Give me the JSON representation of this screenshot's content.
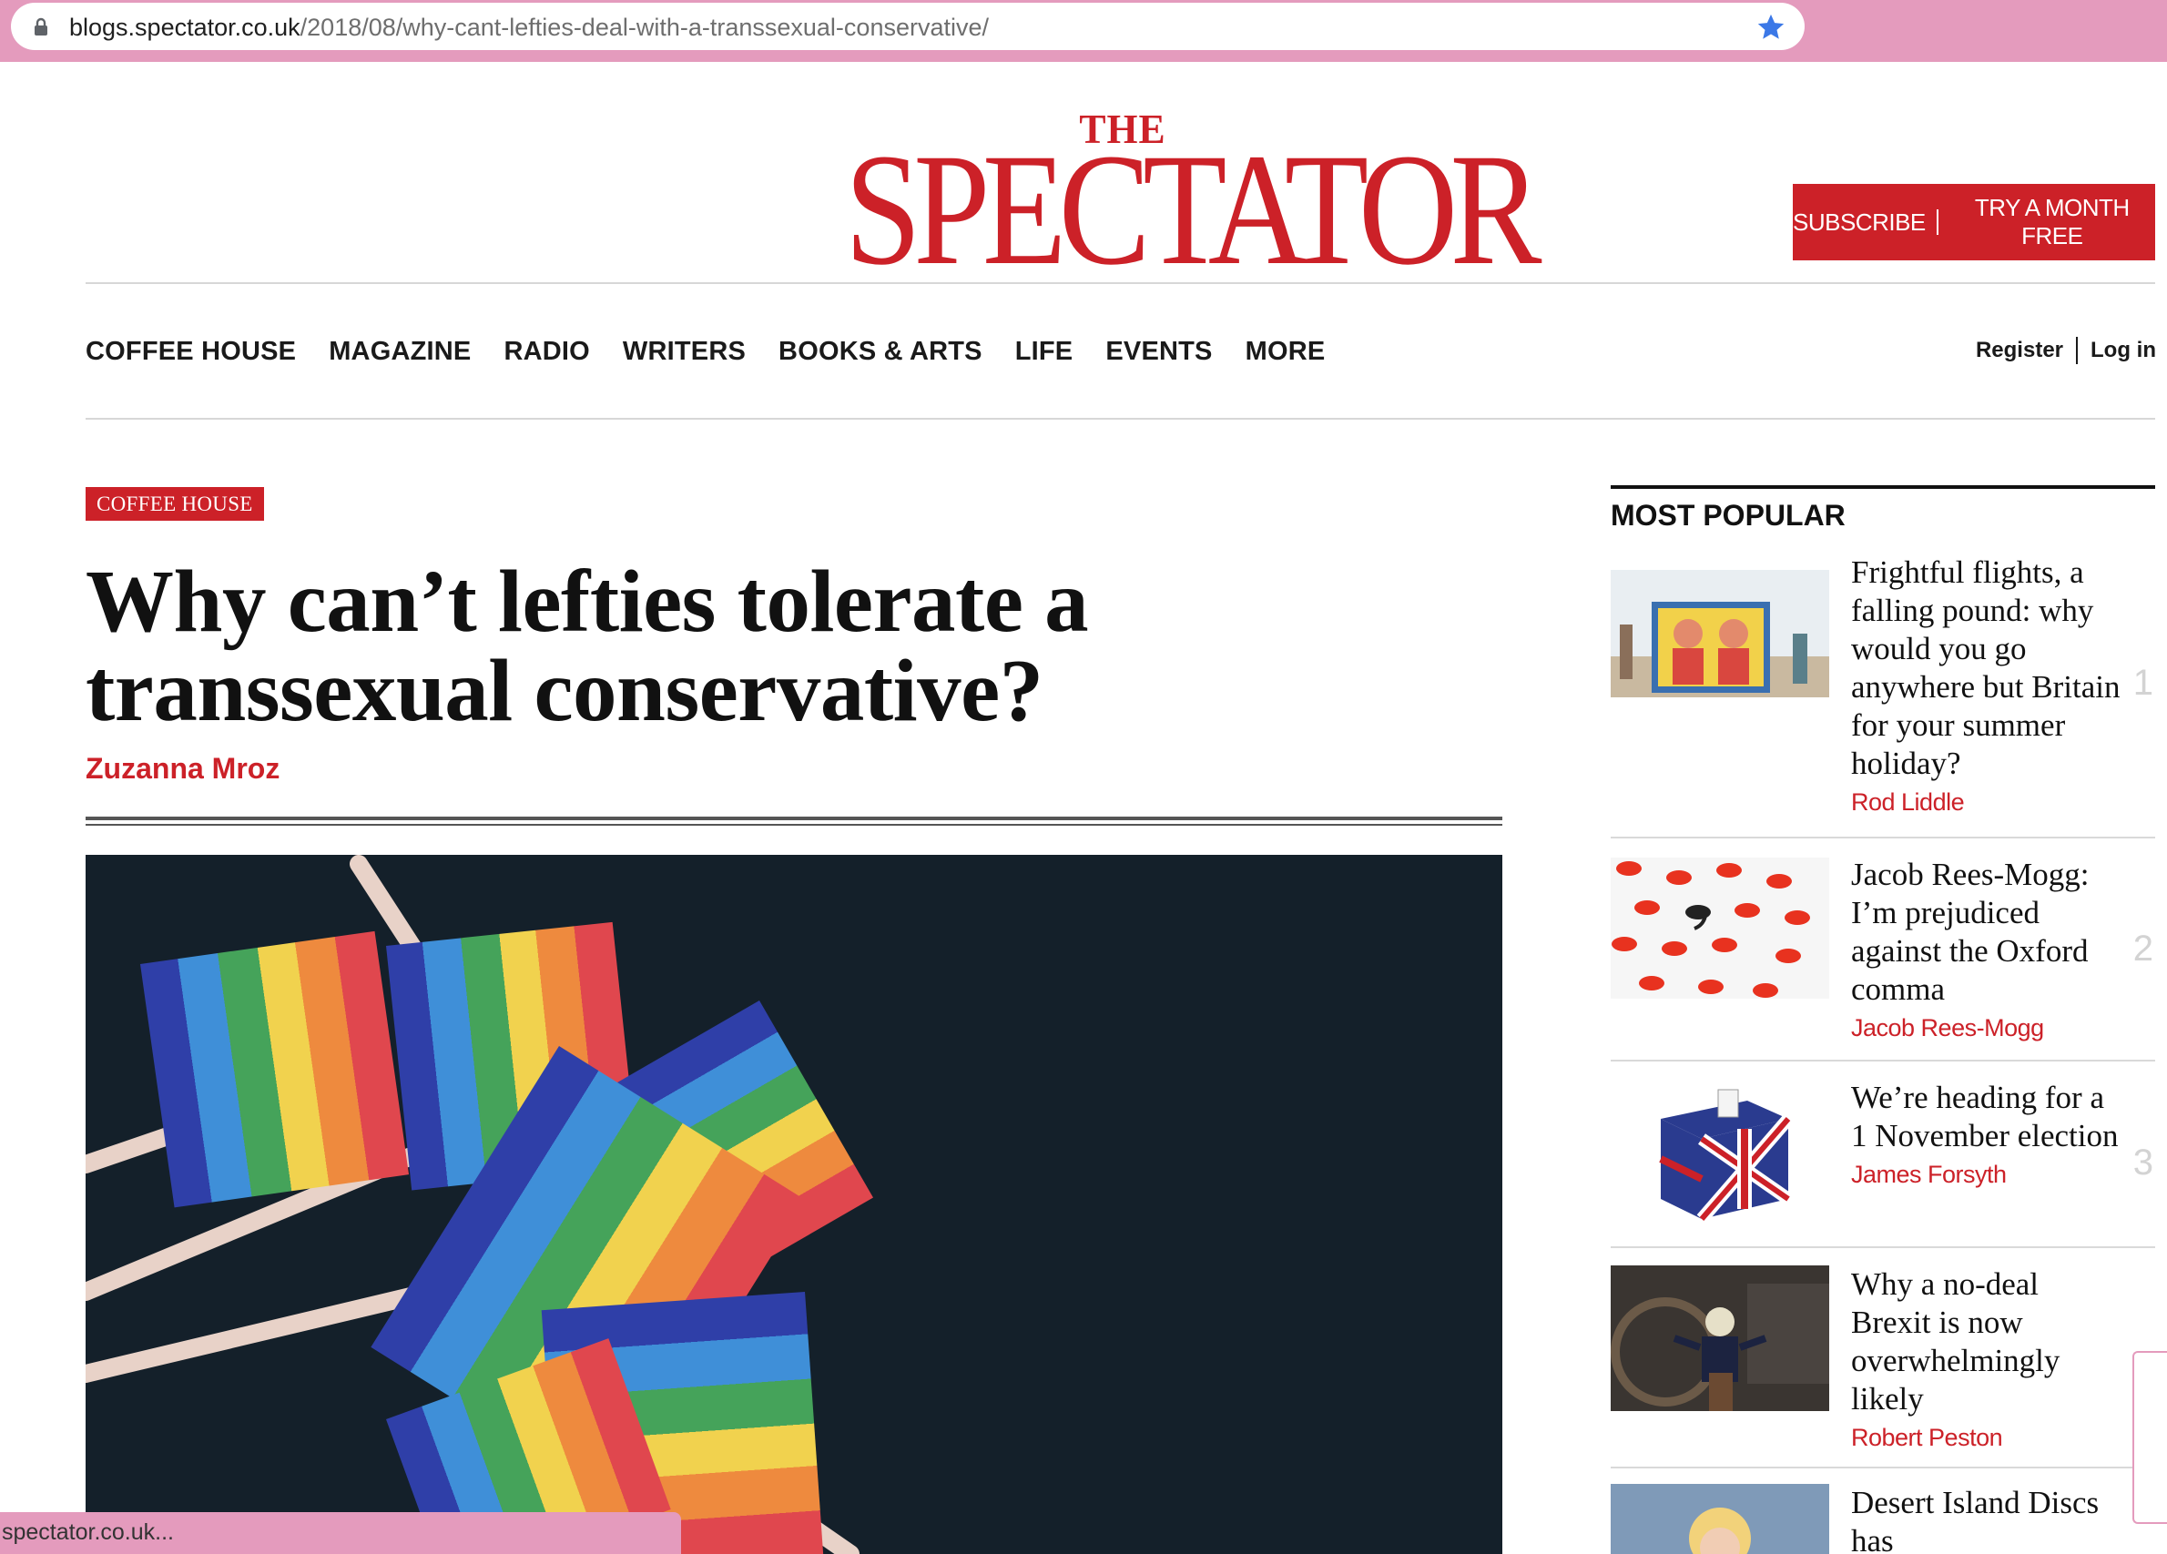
{
  "browser": {
    "url_host": "blogs.spectator.co.uk",
    "url_path": "/2018/08/why-cant-lefties-deal-with-a-transsexual-conservative/",
    "status_text": "spectator.co.uk..."
  },
  "header": {
    "logo_the": "THE",
    "logo_main": "SPECTATOR",
    "subscribe_label": "SUBSCRIBE",
    "subscribe_offer": "TRY A MONTH FREE"
  },
  "nav": {
    "items": [
      "COFFEE HOUSE",
      "MAGAZINE",
      "RADIO",
      "WRITERS",
      "BOOKS & ARTS",
      "LIFE",
      "EVENTS",
      "MORE"
    ],
    "register": "Register",
    "login": "Log in"
  },
  "article": {
    "section": "COFFEE HOUSE",
    "headline": "Why can’t lefties tolerate a transsexual conservative?",
    "author": "Zuzanna Mroz"
  },
  "sidebar": {
    "title": "MOST POPULAR",
    "items": [
      {
        "title": "Frightful flights, a falling pound: why would you go anywhere but Britain for your summer holiday?",
        "author": "Rod Liddle",
        "rank": "1"
      },
      {
        "title": "Jacob Rees-Mogg: I’m prejudiced against the Oxford comma",
        "author": "Jacob Rees-Mogg",
        "rank": "2"
      },
      {
        "title": "We’re heading for a 1 November election",
        "author": "James Forsyth",
        "rank": "3"
      },
      {
        "title": "Why a no-deal Brexit is now overwhelmingly likely",
        "author": "Robert Peston",
        "rank": ""
      },
      {
        "title": "Desert Island Discs has",
        "author": "",
        "rank": ""
      }
    ]
  },
  "colors": {
    "brand_red": "#cc2128",
    "chrome_pink": "#e49bbd",
    "star_blue": "#3b78e7"
  },
  "icons": [
    "lock-icon",
    "bookmark-star-icon"
  ]
}
